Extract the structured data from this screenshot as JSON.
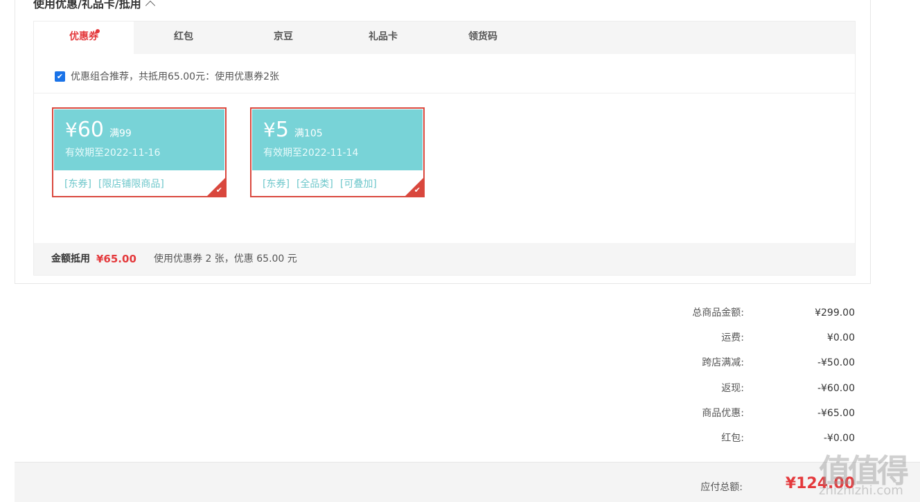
{
  "section": {
    "title": "使用优惠/礼品卡/抵用"
  },
  "tabs": [
    {
      "label": "优惠券"
    },
    {
      "label": "红包"
    },
    {
      "label": "京豆"
    },
    {
      "label": "礼品卡"
    },
    {
      "label": "领货码"
    }
  ],
  "combo": {
    "checked": true,
    "text": "优惠组合推荐，共抵用65.00元：使用优惠券2张"
  },
  "coupons": [
    {
      "currency": "¥",
      "amount": "60",
      "condition": "满99",
      "validity": "有效期至2022-11-16",
      "tags": [
        "[东券]",
        "[限店铺限商品]"
      ],
      "selected": true
    },
    {
      "currency": "¥",
      "amount": "5",
      "condition": "满105",
      "validity": "有效期至2022-11-14",
      "tags": [
        "[东券]",
        "[全品类]",
        "[可叠加]"
      ],
      "selected": true
    }
  ],
  "summary": {
    "label": "金额抵用",
    "amount": "¥65.00",
    "description": "使用优惠券 2 张，优惠 65.00 元"
  },
  "price_rows": [
    {
      "label": "总商品金额:",
      "value": "¥299.00"
    },
    {
      "label": "运费:",
      "value": "¥0.00"
    },
    {
      "label": "跨店满减:",
      "value": "-¥50.00"
    },
    {
      "label": "返现:",
      "value": "-¥60.00"
    },
    {
      "label": "商品优惠:",
      "value": "-¥65.00"
    },
    {
      "label": "红包:",
      "value": "-¥0.00"
    }
  ],
  "total": {
    "label": "应付总额:",
    "value": "¥124.00"
  },
  "watermark": {
    "logo": "值值得",
    "url": "zhizhizhi.com"
  },
  "colors": {
    "accent": "#e4393c",
    "coupon_bg": "#78d3d7",
    "coupon_border": "#d9473d"
  }
}
